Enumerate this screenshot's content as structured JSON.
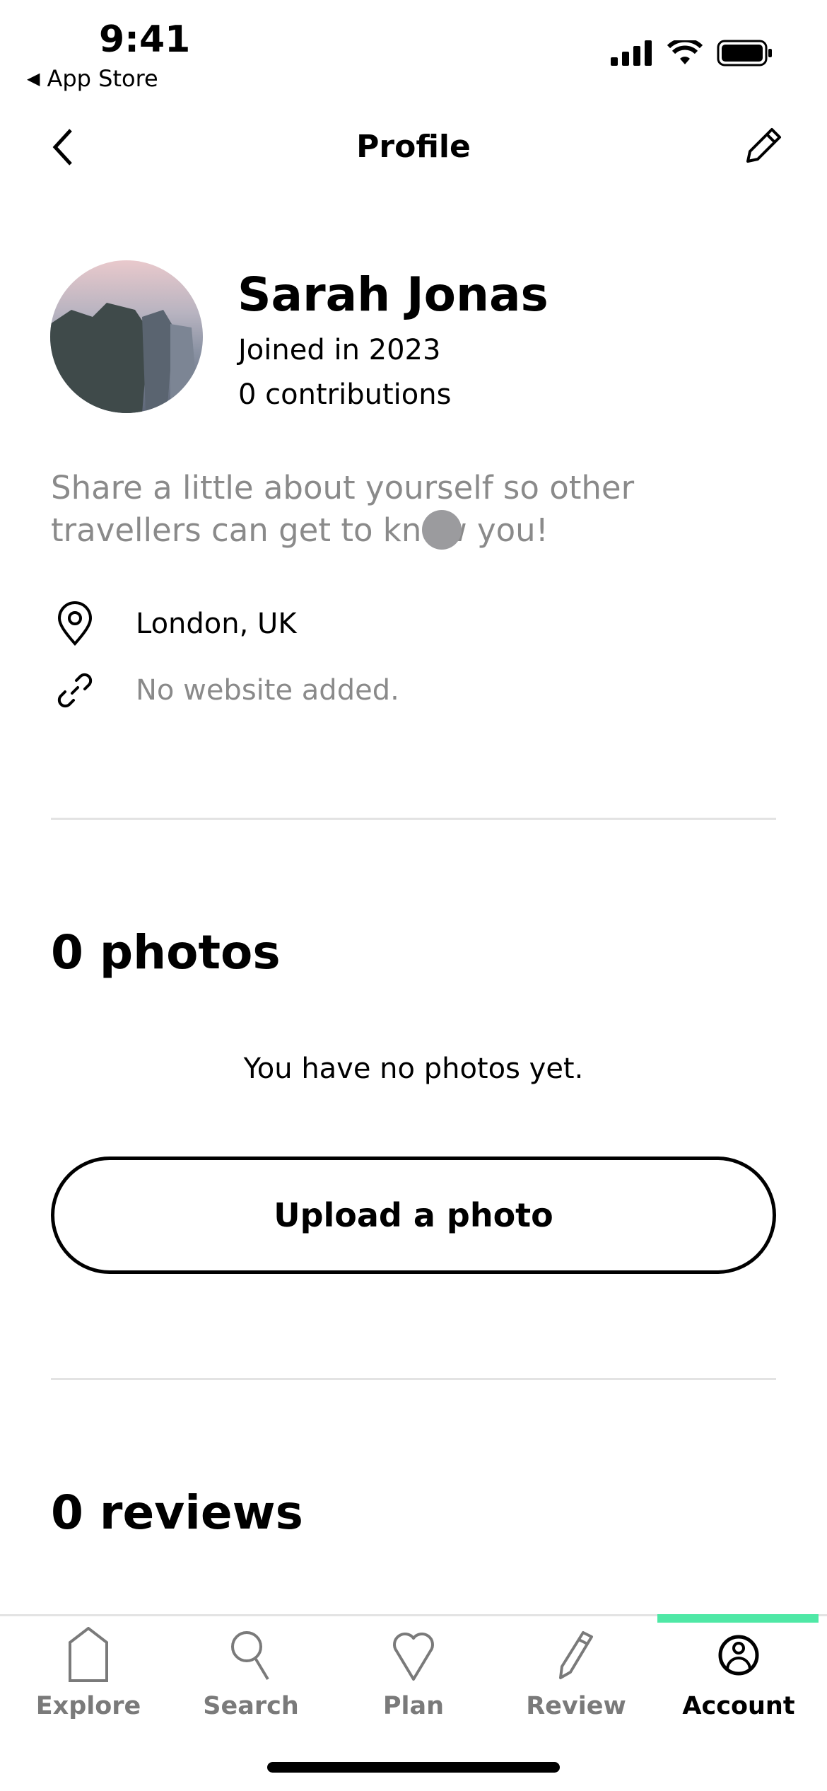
{
  "status_bar": {
    "time": "9:41",
    "back_app": "App Store"
  },
  "header": {
    "title": "Profile"
  },
  "profile": {
    "name": "Sarah Jonas",
    "joined": "Joined in 2023",
    "contributions": "0 contributions",
    "bio_placeholder": "Share a little about yourself so other travellers can get to know you!",
    "location": "London, UK",
    "website": "No website added."
  },
  "photos": {
    "title": "0 photos",
    "empty": "You have no photos yet.",
    "upload_label": "Upload a photo"
  },
  "reviews": {
    "title": "0 reviews"
  },
  "tabs": [
    {
      "label": "Explore",
      "icon": "home-icon"
    },
    {
      "label": "Search",
      "icon": "search-icon"
    },
    {
      "label": "Plan",
      "icon": "heart-icon"
    },
    {
      "label": "Review",
      "icon": "pencil-icon"
    },
    {
      "label": "Account",
      "icon": "account-icon",
      "active": true
    }
  ],
  "colors": {
    "accent": "#4fe8a6",
    "muted": "#8a8a8a"
  }
}
